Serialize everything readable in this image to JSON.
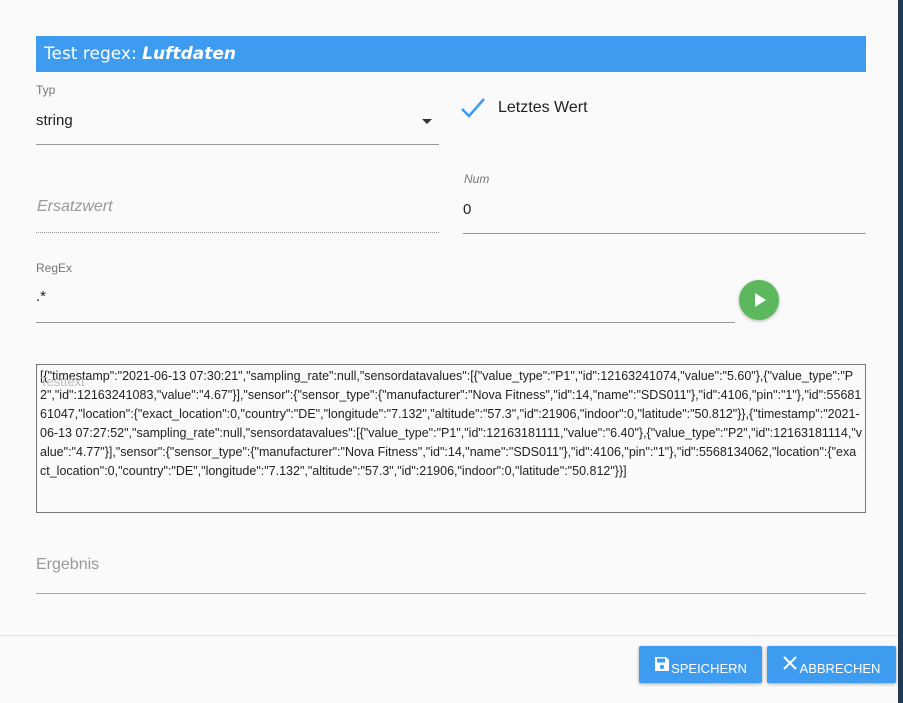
{
  "dialog": {
    "title_prefix": "Test regex: ",
    "title_name": "Luftdaten"
  },
  "typ": {
    "label": "Typ",
    "value": "string"
  },
  "last_value": {
    "label": "Letztes Wert",
    "checked": true
  },
  "ersatzwert": {
    "placeholder": "Ersatzwert"
  },
  "num": {
    "label": "Num",
    "value": "0"
  },
  "regex": {
    "label": "RegEx",
    "value": ".*"
  },
  "testtext": {
    "label": "Testtext",
    "value": "[{\"timestamp\":\"2021-06-13 07:30:21\",\"sampling_rate\":null,\"sensordatavalues\":[{\"value_type\":\"P1\",\"id\":12163241074,\"value\":\"5.60\"},{\"value_type\":\"P2\",\"id\":12163241083,\"value\":\"4.67\"}],\"sensor\":{\"sensor_type\":{\"manufacturer\":\"Nova Fitness\",\"id\":14,\"name\":\"SDS011\"},\"id\":4106,\"pin\":\"1\"},\"id\":5568161047,\"location\":{\"exact_location\":0,\"country\":\"DE\",\"longitude\":\"7.132\",\"altitude\":\"57.3\",\"id\":21906,\"indoor\":0,\"latitude\":\"50.812\"}},{\"timestamp\":\"2021-06-13 07:27:52\",\"sampling_rate\":null,\"sensordatavalues\":[{\"value_type\":\"P1\",\"id\":12163181111,\"value\":\"6.40\"},{\"value_type\":\"P2\",\"id\":12163181114,\"value\":\"4.77\"}],\"sensor\":{\"sensor_type\":{\"manufacturer\":\"Nova Fitness\",\"id\":14,\"name\":\"SDS011\"},\"id\":4106,\"pin\":\"1\"},\"id\":5568134062,\"location\":{\"exact_location\":0,\"country\":\"DE\",\"longitude\":\"7.132\",\"altitude\":\"57.3\",\"id\":21906,\"indoor\":0,\"latitude\":\"50.812\"}}]"
  },
  "ergebnis": {
    "placeholder": "Ergebnis"
  },
  "buttons": {
    "save": "SPEICHERN",
    "cancel": "ABBRECHEN"
  },
  "colors": {
    "primary": "#3d9bf0",
    "run": "#5cb85c"
  }
}
